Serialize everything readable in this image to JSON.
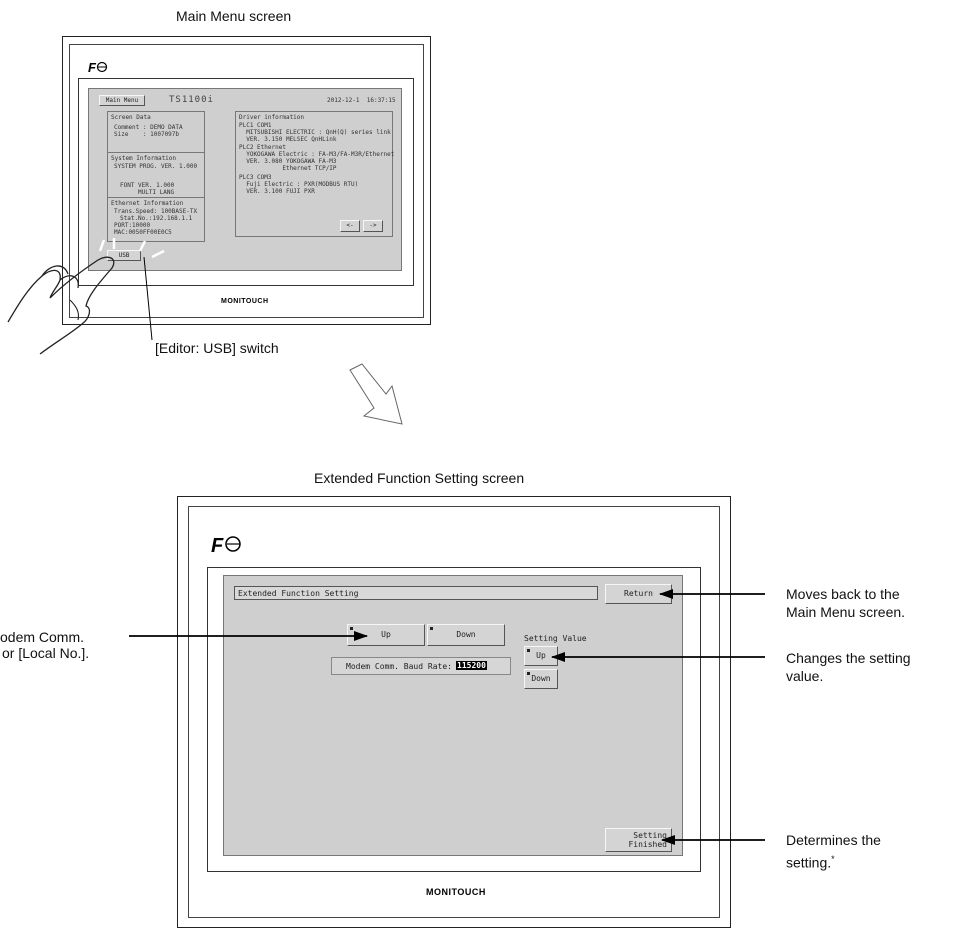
{
  "top": {
    "caption": "Main Menu screen",
    "brand": "MONITOUCH",
    "screen": {
      "menu_button": "Main Menu",
      "model": "TS1100i",
      "datetime": "2012-12-1  16:37:15",
      "screen_data": {
        "heading": "Screen Data",
        "comment": "Comment : DEMO DATA",
        "size": "Size    : 1007097b"
      },
      "system_info": {
        "heading": "System Information",
        "sysprog": "SYSTEM PROG. VER. 1.000",
        "font": "FONT VER. 1.000",
        "lang": "MULTI LANG"
      },
      "ethernet_info": {
        "heading": "Ethernet Information",
        "speed": "Trans.Speed: 100BASE-TX",
        "station": "Stat.No.:192.168.1.1",
        "port": "PORT:10000",
        "mac": "MAC:0050FF00E0C5"
      },
      "driver": {
        "heading": "Driver information",
        "plc1": "PLC1 COM1\n  MITSUBISHI ELECTRIC : QnH(Q) series link\n  VER. 3.150 MELSEC QnHLink",
        "plc2": "PLC2 Ethernet\n  YOKOGAWA Electric : FA-M3/FA-M3R/Ethernet\n  VER. 3.080 YOKOGAWA FA-M3\n            Ethernet TCP/IP",
        "plc3": "PLC3 COM3\n  Fuji Electric : PXR(MODBUS RTU)\n  VER. 3.100 FUJI PXR",
        "prev": "<-",
        "next": "->"
      },
      "usb_button": "USB"
    },
    "callout": "[Editor: USB] switch"
  },
  "bottom": {
    "caption": "Extended Function Setting screen",
    "brand": "MONITOUCH",
    "screen": {
      "title": "Extended Function Setting",
      "return_button": "Return",
      "up_button": "Up",
      "down_button": "Down",
      "baud_label": "Modem Comm. Baud Rate:",
      "baud_value": "115200",
      "setting_value_label": "Setting Value",
      "sv_up": "Up",
      "sv_down": "Down",
      "finish_line1": "Setting",
      "finish_line2": "Finished"
    },
    "annotations": {
      "left_line1": "odem Comm.",
      "left_line2": "or [Local No.].",
      "return_line1": "Moves back to the",
      "return_line2": "Main Menu screen.",
      "change_line1": "Changes the setting",
      "change_line2": "value.",
      "finish_line1": "Determines the",
      "finish_line2": "setting.",
      "finish_mark": "*"
    }
  },
  "colors": {
    "screen_bg": "#cfcfcf",
    "bezel": "#ffffff",
    "button": "#d4d4d4",
    "text_highlight": "#000000"
  }
}
